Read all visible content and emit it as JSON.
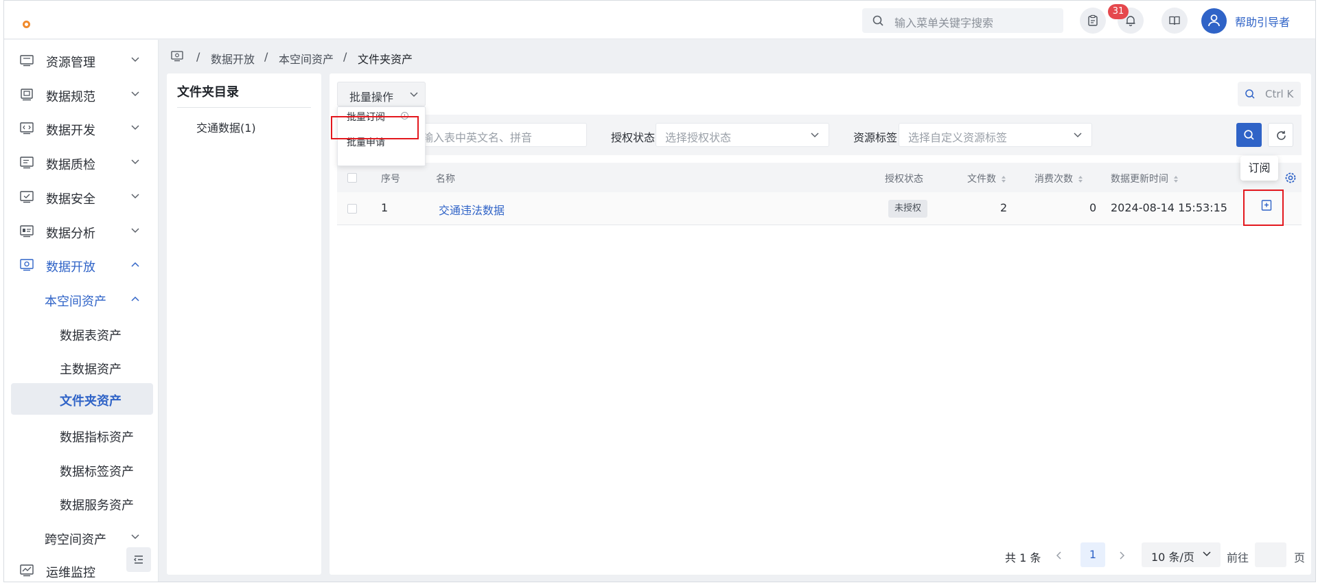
{
  "topbar": {
    "search_placeholder": "输入菜单关键字搜索",
    "notification_count": "31",
    "username": "帮助引导者"
  },
  "sidebar": {
    "items": [
      {
        "label": "资源管理",
        "icon": "monitor-icon"
      },
      {
        "label": "数据规范",
        "icon": "server-icon"
      },
      {
        "label": "数据开发",
        "icon": "code-icon"
      },
      {
        "label": "数据质检",
        "icon": "doc-icon"
      },
      {
        "label": "数据安全",
        "icon": "shield-check-icon"
      },
      {
        "label": "数据分析",
        "icon": "chart-icon"
      },
      {
        "label": "数据开放",
        "icon": "share-icon"
      }
    ],
    "sub_group": "本空间资产",
    "leaves": [
      "数据表资产",
      "主数据资产",
      "文件夹资产",
      "数据指标资产",
      "数据标签资产",
      "数据服务资产"
    ],
    "cross_group": "跨空间资产",
    "ops_item": "运维监控"
  },
  "breadcrumb": {
    "items": [
      "数据开放",
      "本空间资产",
      "文件夹资产"
    ]
  },
  "folder_panel": {
    "title": "文件夹目录",
    "nodes": [
      "交通数据(1)"
    ]
  },
  "toolbar": {
    "batch_label": "批量操作",
    "ctrl_k": "Ctrl K",
    "dropdown_items": [
      "批量订阅",
      "批量申请"
    ]
  },
  "filters": {
    "name_placeholder": "输入表中英文名、拼音",
    "auth_label": "授权状态",
    "auth_placeholder": "选择授权状态",
    "tag_label": "资源标签",
    "tag_placeholder": "选择自定义资源标签"
  },
  "table": {
    "columns": [
      "序号",
      "名称",
      "授权状态",
      "文件数",
      "消费次数",
      "数据更新时间"
    ],
    "rows": [
      {
        "index": "1",
        "name": "交通违法数据",
        "auth": "未授权",
        "files": "2",
        "consumed": "0",
        "updated": "2024-08-14 15:53:15"
      }
    ],
    "action_tooltip": "订阅"
  },
  "pagination": {
    "total": "共 1 条",
    "current": "1",
    "page_size": "10 条/页",
    "goto": "前往",
    "page": "页"
  },
  "colors": {
    "accent": "#2f63c7",
    "highlight": "#e3171d",
    "badge": "#e5484d",
    "logo": "#f08a2c"
  }
}
